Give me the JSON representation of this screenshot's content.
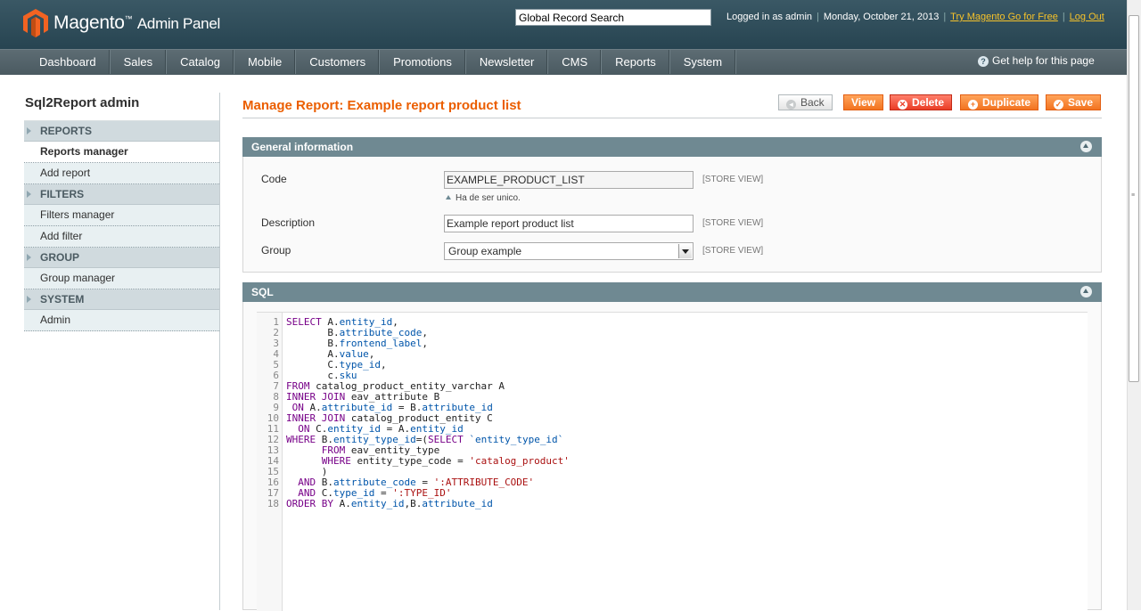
{
  "header": {
    "logo_name": "Magento",
    "logo_suffix": "Admin Panel",
    "search_value": "Global Record Search",
    "logged_in": "Logged in as admin",
    "date": "Monday, October 21, 2013",
    "try_link": "Try Magento Go for Free",
    "logout_link": "Log Out"
  },
  "nav": {
    "items": [
      "Dashboard",
      "Sales",
      "Catalog",
      "Mobile",
      "Customers",
      "Promotions",
      "Newsletter",
      "CMS",
      "Reports",
      "System"
    ],
    "help": "Get help for this page"
  },
  "sidebar": {
    "title": "Sql2Report admin",
    "sections": [
      {
        "label": "REPORTS",
        "items": [
          "Reports manager",
          "Add report"
        ]
      },
      {
        "label": "FILTERS",
        "items": [
          "Filters manager",
          "Add filter"
        ]
      },
      {
        "label": "GROUP",
        "items": [
          "Group manager"
        ]
      },
      {
        "label": "SYSTEM",
        "items": [
          "Admin"
        ]
      }
    ],
    "active_item": "Reports manager"
  },
  "page": {
    "title": "Manage Report: Example report product list",
    "buttons": {
      "back": "Back",
      "view": "View",
      "delete": "Delete",
      "duplicate": "Duplicate",
      "save": "Save"
    }
  },
  "general": {
    "heading": "General information",
    "code_label": "Code",
    "code_value": "EXAMPLE_PRODUCT_LIST",
    "code_note": "Ha de ser unico.",
    "description_label": "Description",
    "description_value": "Example report product list",
    "group_label": "Group",
    "group_value": "Group example",
    "scope": "[STORE VIEW]"
  },
  "sql": {
    "heading": "SQL",
    "lines": [
      "SELECT A.entity_id,",
      "       B.attribute_code,",
      "       B.frontend_label,",
      "       A.value,",
      "       C.type_id,",
      "       c.sku",
      "FROM catalog_product_entity_varchar A",
      "INNER JOIN eav_attribute B",
      " ON A.attribute_id = B.attribute_id",
      "INNER JOIN catalog_product_entity C",
      "  ON C.entity_id = A.entity_id",
      "WHERE B.entity_type_id=(SELECT `entity_type_id`",
      "      FROM eav_entity_type",
      "      WHERE entity_type_code = 'catalog_product'",
      "      )",
      "  AND B.attribute_code = ':ATTRIBUTE_CODE'",
      "  AND C.type_id = ':TYPE_ID'",
      "ORDER BY A.entity_id,B.attribute_id"
    ]
  }
}
